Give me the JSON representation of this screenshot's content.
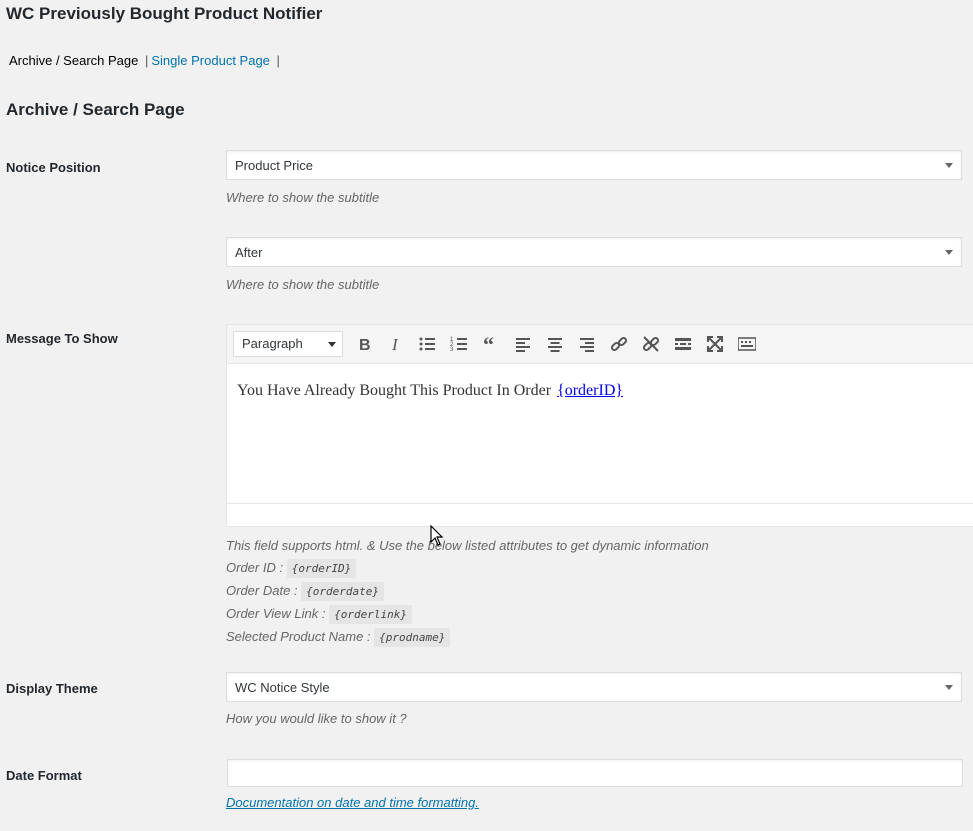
{
  "page": {
    "title": "WC Previously Bought Product Notifier"
  },
  "tabs": {
    "current": "Archive / Search Page",
    "other": "Single Product Page",
    "separator": "|"
  },
  "section": {
    "title": "Archive / Search Page"
  },
  "notice_position": {
    "label": "Notice Position",
    "select1_value": "Product Price",
    "select1_desc": "Where to show the subtitle",
    "select2_value": "After",
    "select2_desc": "Where to show the subtitle"
  },
  "message": {
    "label": "Message To Show",
    "format_select": "Paragraph",
    "toolbar_icons": [
      "bold-icon",
      "italic-icon",
      "bullet-list-icon",
      "numbered-list-icon",
      "blockquote-icon",
      "align-left-icon",
      "align-center-icon",
      "align-right-icon",
      "link-icon",
      "unlink-icon",
      "read-more-icon",
      "fullscreen-icon",
      "toolbar-toggle-icon"
    ],
    "content_text": "You Have Already Bought This Product In Order",
    "content_link": "{orderID}",
    "help_intro": "This field supports html. & Use the below listed attributes to get dynamic information",
    "attrs": [
      {
        "label": "Order ID :",
        "code": "{orderID}"
      },
      {
        "label": "Order Date :",
        "code": "{orderdate}"
      },
      {
        "label": "Order View Link :",
        "code": "{orderlink}"
      },
      {
        "label": "Selected Product Name :",
        "code": "{prodname}"
      }
    ]
  },
  "display_theme": {
    "label": "Display Theme",
    "value": "WC Notice Style",
    "desc": "How you would like to show it ?"
  },
  "date_format": {
    "label": "Date Format",
    "value": "",
    "link": "Documentation on date and time formatting."
  },
  "colors": {
    "link": "#0073aa",
    "background": "#f1f1f1"
  }
}
